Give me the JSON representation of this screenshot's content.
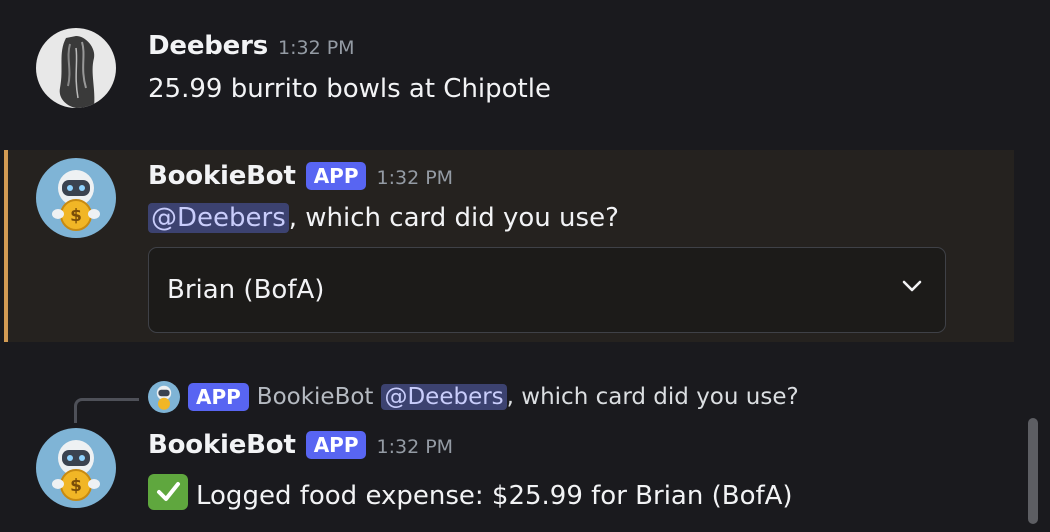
{
  "messages": [
    {
      "username": "Deebers",
      "time": "1:32 PM",
      "text": "25.99 burrito bowls at Chipotle"
    },
    {
      "username": "BookieBot",
      "app_tag": "APP",
      "time": "1:32 PM",
      "mention": "@Deebers",
      "text": ", which card did you use?",
      "select": {
        "value": "Brian (BofA)"
      }
    },
    {
      "reply": {
        "app_tag": "APP",
        "username": "BookieBot",
        "mention": "@Deebers",
        "text": ", which card did you use?"
      },
      "username": "BookieBot",
      "app_tag": "APP",
      "time": "1:32 PM",
      "text": "Logged food expense: $25.99 for Brian (BofA)"
    }
  ],
  "colors": {
    "background": "#1a1a1e",
    "app_tag": "#5865f2",
    "highlight_bar": "#d29b54",
    "mention_bg": "#3c4270",
    "check_green": "#5fa73e"
  },
  "icons": [
    "user-avatar",
    "bot-avatar",
    "chevron-down-icon",
    "check-mark-icon"
  ]
}
